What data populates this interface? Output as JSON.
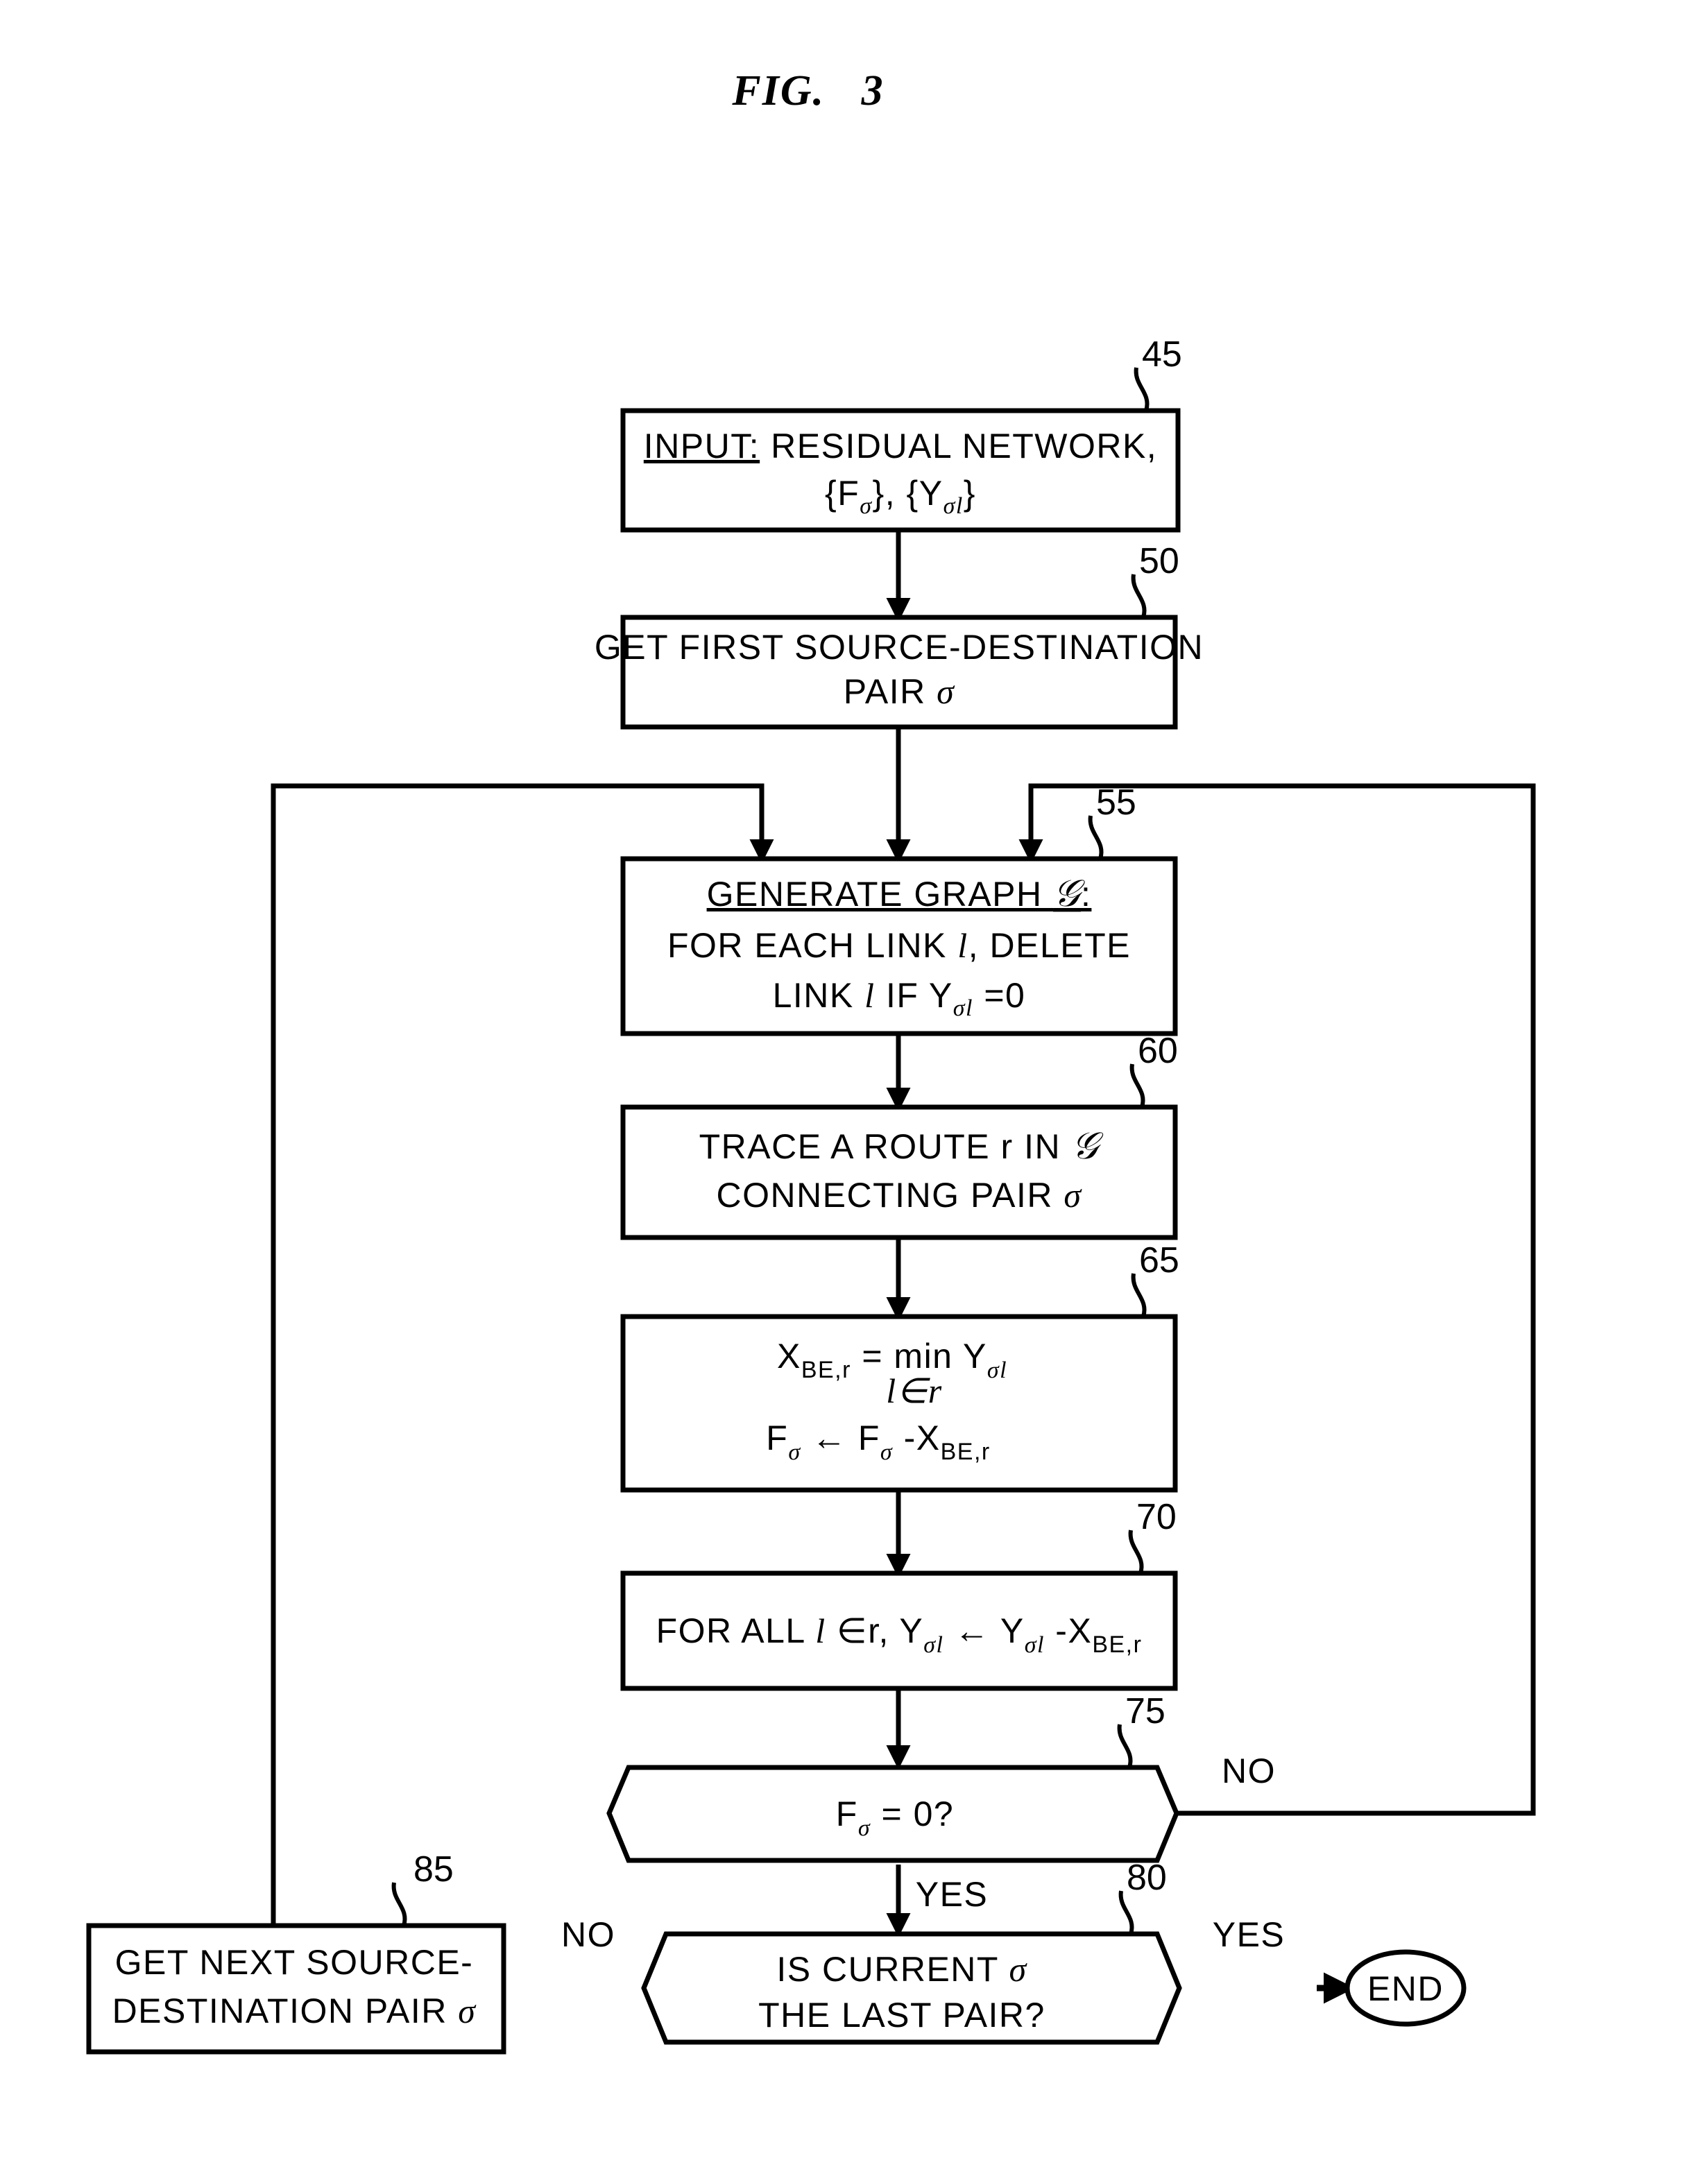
{
  "figure": {
    "title": "FIG.   3",
    "domain": "patent-flowchart"
  },
  "nodes": [
    {
      "ref": "45",
      "name": "input-residual-network",
      "shape": "process",
      "lines": [
        "INPUT:  RESIDUAL NETWORK,",
        "{Fσ},  {Yσl}"
      ],
      "line1_underlined_prefix": "INPUT:",
      "text": "INPUT: RESIDUAL NETWORK, {Fσ}, {Yσl}"
    },
    {
      "ref": "50",
      "name": "get-first-source-destination-pair",
      "shape": "process",
      "lines": [
        "GET FIRST SOURCE-DESTINATION",
        "PAIR σ"
      ],
      "text": "GET FIRST SOURCE-DESTINATION PAIR σ"
    },
    {
      "ref": "55",
      "name": "generate-graph",
      "shape": "process",
      "lines": [
        "GENERATE GRAPH 𝒢:",
        "FOR EACH LINK l , DELETE",
        "LINK l IF Yσl =0"
      ],
      "line1_underlined": true,
      "text": "GENERATE GRAPH G: FOR EACH LINK l, DELETE LINK l IF Yσl = 0"
    },
    {
      "ref": "60",
      "name": "trace-route",
      "shape": "process",
      "lines": [
        "TRACE A ROUTE r IN 𝒢",
        "CONNECTING PAIR σ"
      ],
      "text": "TRACE A ROUTE r IN G CONNECTING PAIR σ"
    },
    {
      "ref": "65",
      "name": "compute-x-be-r",
      "shape": "process",
      "lines": [
        "X BE,r  =  min  Y σl",
        "l∈r",
        "Fσ  ←  Fσ -X BE,r"
      ],
      "text": "X_BE,r = min over l∈r of Y_σl ;  F_σ ← F_σ - X_BE,r"
    },
    {
      "ref": "70",
      "name": "update-y-sigma-l",
      "shape": "process",
      "lines": [
        "FOR ALL l ∈r,  Yσl ← Yσl -X BE,r"
      ],
      "text": "FOR ALL l ∈ r, Y_σl ← Y_σl - X_BE,r"
    },
    {
      "ref": "75",
      "name": "decision-f-sigma-zero",
      "shape": "decision",
      "lines": [
        "Fσ = 0?"
      ],
      "text": "Fσ = 0?"
    },
    {
      "ref": "80",
      "name": "decision-is-last-pair",
      "shape": "decision",
      "lines": [
        "IS CURRENT σ",
        "THE LAST PAIR?"
      ],
      "text": "IS CURRENT σ THE LAST PAIR?"
    },
    {
      "ref": "85",
      "name": "get-next-source-destination-pair",
      "shape": "process",
      "lines": [
        "GET NEXT SOURCE-",
        "DESTINATION PAIR σ"
      ],
      "text": "GET NEXT SOURCE-DESTINATION PAIR σ"
    },
    {
      "ref": "",
      "name": "terminator-end",
      "shape": "terminator",
      "lines": [
        "END"
      ],
      "text": "END"
    }
  ],
  "node_text": {
    "n45_l1_a": "INPUT:",
    "n45_l1_b": "RESIDUAL NETWORK,",
    "n45_l2_a": "{F",
    "n45_l2_sub1": "σ",
    "n45_l2_b": "},  {Y",
    "n45_l2_sub2": "σl",
    "n45_l2_c": "}",
    "n50_l1": "GET FIRST SOURCE-DESTINATION",
    "n50_l2_a": "PAIR ",
    "n50_l2_b": "σ",
    "n55_l1_a": "GENERATE GRAPH ",
    "n55_l1_b": "𝒢",
    "n55_l1_c": ":",
    "n55_l2_a": "FOR EACH LINK ",
    "n55_l2_b": "l",
    "n55_l2_c": ", DELETE",
    "n55_l3_a": "LINK ",
    "n55_l3_b": "l",
    "n55_l3_c": " IF Y",
    "n55_l3_sub": "σl",
    "n55_l3_d": " =0",
    "n60_l1_a": "TRACE A ROUTE r IN ",
    "n60_l1_b": "𝒢",
    "n60_l2_a": "CONNECTING PAIR ",
    "n60_l2_b": "σ",
    "n65_l1_a": "X",
    "n65_l1_sub1": "BE,r",
    "n65_l1_b": " =  min  Y",
    "n65_l1_sub2": "σl",
    "n65_l2": "l∈r",
    "n65_l3_a": "F",
    "n65_l3_sub1": "σ",
    "n65_l3_b": "  ←   F",
    "n65_l3_sub2": "σ",
    "n65_l3_c": " -X",
    "n65_l3_sub3": "BE,r",
    "n70_a": "FOR ALL ",
    "n70_b": "l",
    "n70_c": " ∈r,  Y",
    "n70_sub1": "σl",
    "n70_d": " ← Y",
    "n70_sub2": "σl",
    "n70_e": " -X",
    "n70_sub3": "BE,r",
    "n75_a": "F",
    "n75_sub": "σ",
    "n75_b": " = 0?",
    "n80_l1_a": "IS CURRENT ",
    "n80_l1_b": "σ",
    "n80_l2": "THE LAST PAIR?",
    "n85_l1": "GET NEXT SOURCE-",
    "n85_l2_a": "DESTINATION PAIR ",
    "n85_l2_b": "σ",
    "end_label": "END"
  },
  "ref_numbers": {
    "r45": "45",
    "r50": "50",
    "r55": "55",
    "r60": "60",
    "r65": "65",
    "r70": "70",
    "r75": "75",
    "r80": "80",
    "r85": "85"
  },
  "edge_labels": {
    "decision75_no": "NO",
    "decision75_yes": "YES",
    "decision80_no": "NO",
    "decision80_yes": "YES"
  },
  "colors": {
    "ink": "#000000",
    "paper": "#ffffff"
  }
}
